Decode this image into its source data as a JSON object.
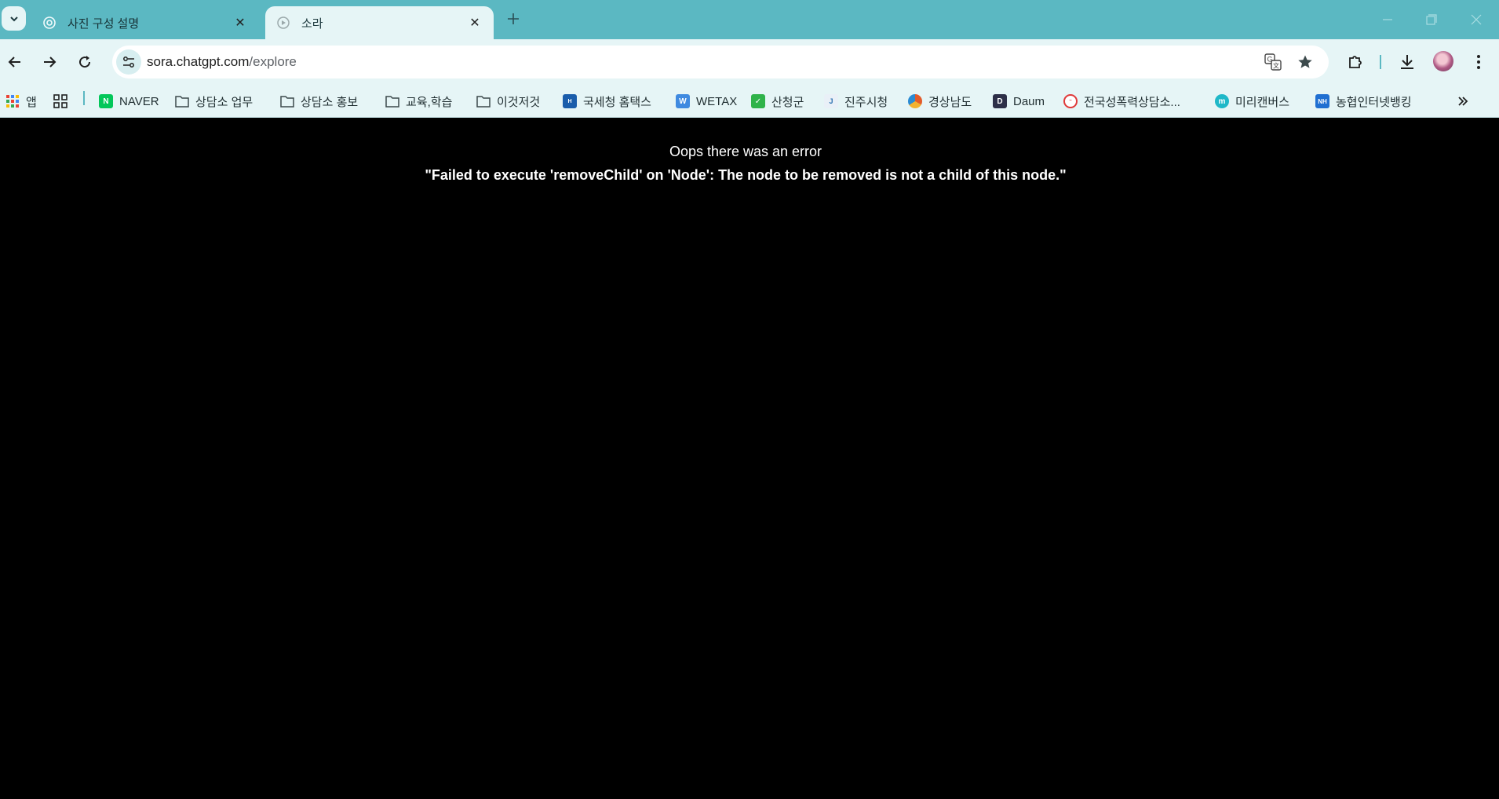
{
  "tabs": [
    {
      "title": "사진 구성 설명",
      "active": false
    },
    {
      "title": "소라",
      "active": true
    }
  ],
  "address_bar": {
    "domain": "sora.chatgpt.com",
    "path": "/explore"
  },
  "bookmarks": [
    {
      "label": "앱",
      "icon": "apps-grid-icon"
    },
    {
      "label": "",
      "icon": "grid-icon"
    },
    {
      "label": "NAVER",
      "icon": "naver-icon",
      "color": "#03c75a"
    },
    {
      "label": "상담소 업무",
      "icon": "folder-icon"
    },
    {
      "label": "상담소 홍보",
      "icon": "folder-icon"
    },
    {
      "label": "교육,학습",
      "icon": "folder-icon"
    },
    {
      "label": "이것저것",
      "icon": "folder-icon"
    },
    {
      "label": "국세청 홈택스",
      "icon": "hometax-icon",
      "color": "#1a5dab"
    },
    {
      "label": "WETAX",
      "icon": "wetax-icon",
      "color": "#3f8ae0"
    },
    {
      "label": "산청군",
      "icon": "sancheong-icon",
      "color": "#2fb34a"
    },
    {
      "label": "진주시청",
      "icon": "jinju-icon",
      "color": "#2a6fb0"
    },
    {
      "label": "경상남도",
      "icon": "gyeongnam-icon",
      "color": "#e25b2b"
    },
    {
      "label": "Daum",
      "icon": "daum-icon",
      "color": "#2d2f48"
    },
    {
      "label": "전국성폭력상담소...",
      "icon": "counseling-icon",
      "color": "#e03a3a"
    },
    {
      "label": "미리캔버스",
      "icon": "miricanvas-icon",
      "color": "#1fb8c8"
    },
    {
      "label": "농협인터넷뱅킹",
      "icon": "nh-icon",
      "color": "#1f6fd1"
    }
  ],
  "error": {
    "title": "Oops there was an error",
    "message": "\"Failed to execute 'removeChild' on 'Node': The node to be removed is not a child of this node.\""
  }
}
